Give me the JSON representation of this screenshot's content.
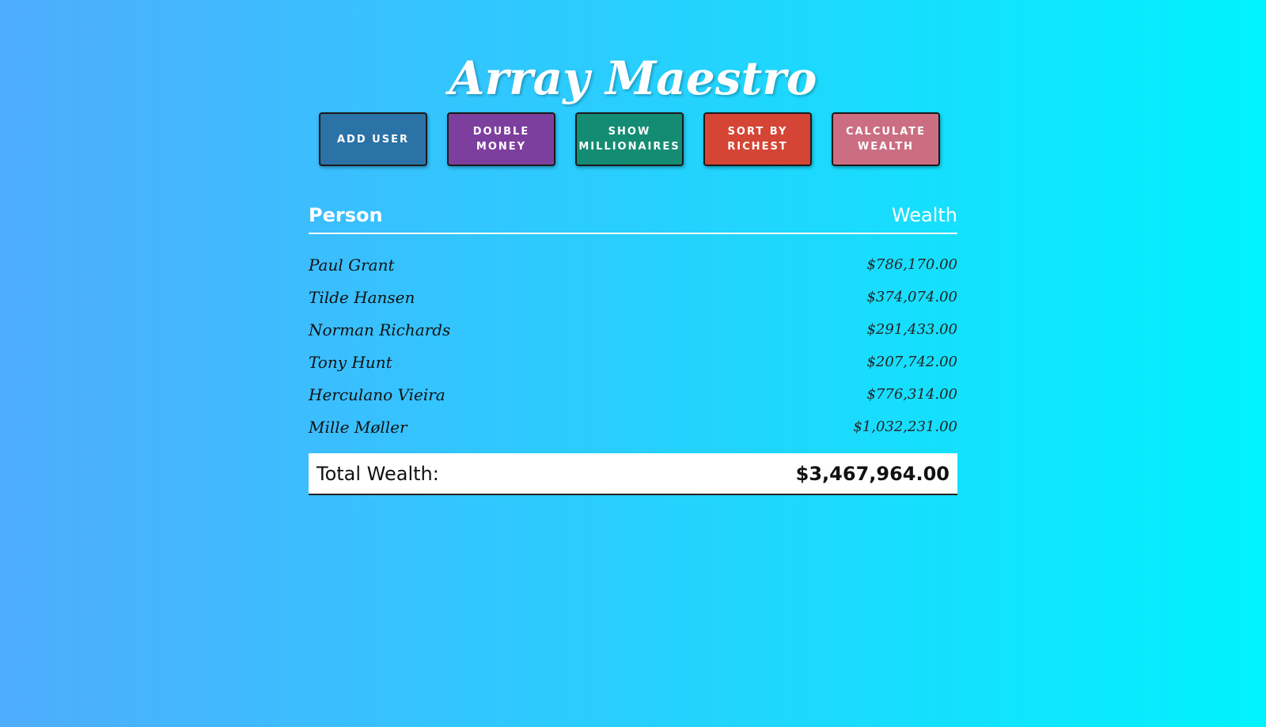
{
  "app": {
    "title": "Array Maestro"
  },
  "toolbar": {
    "buttons": [
      {
        "label": "ADD USER",
        "color": "#2b73a7"
      },
      {
        "label": "DOUBLE MONEY",
        "color": "#7d3f9e"
      },
      {
        "label": "SHOW MILLIONAIRES",
        "color": "#148c73"
      },
      {
        "label": "SORT BY RICHEST",
        "color": "#d54535"
      },
      {
        "label": "CALCULATE WEALTH",
        "color": "#cb6e82"
      }
    ]
  },
  "table": {
    "headers": {
      "person": "Person",
      "wealth": "Wealth"
    },
    "rows": [
      {
        "name": "Paul Grant",
        "wealth": "$786,170.00"
      },
      {
        "name": "Tilde Hansen",
        "wealth": "$374,074.00"
      },
      {
        "name": "Norman Richards",
        "wealth": "$291,433.00"
      },
      {
        "name": "Tony Hunt",
        "wealth": "$207,742.00"
      },
      {
        "name": "Herculano Vieira",
        "wealth": "$776,314.00"
      },
      {
        "name": "Mille Møller",
        "wealth": "$1,032,231.00"
      }
    ]
  },
  "total": {
    "label": "Total Wealth:",
    "value": "$3,467,964.00"
  },
  "colors": {
    "background_start": "#4facfe",
    "background_end": "#00f2fe"
  }
}
